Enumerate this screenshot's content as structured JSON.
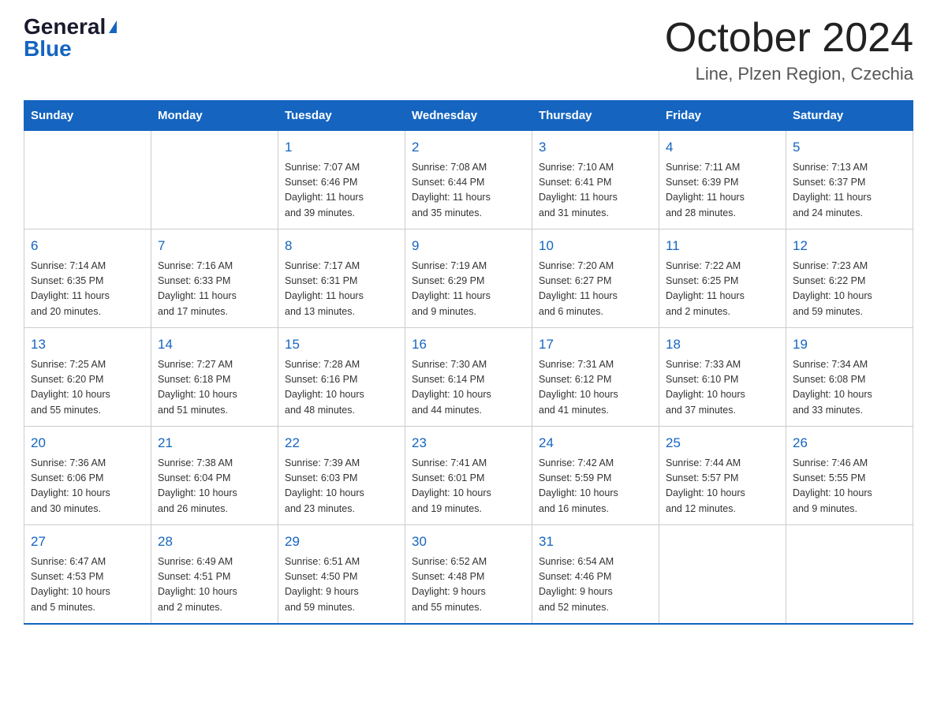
{
  "header": {
    "logo_general": "General",
    "logo_blue": "Blue",
    "title": "October 2024",
    "subtitle": "Line, Plzen Region, Czechia"
  },
  "weekdays": [
    "Sunday",
    "Monday",
    "Tuesday",
    "Wednesday",
    "Thursday",
    "Friday",
    "Saturday"
  ],
  "weeks": [
    [
      {
        "day": "",
        "info": ""
      },
      {
        "day": "",
        "info": ""
      },
      {
        "day": "1",
        "info": "Sunrise: 7:07 AM\nSunset: 6:46 PM\nDaylight: 11 hours\nand 39 minutes."
      },
      {
        "day": "2",
        "info": "Sunrise: 7:08 AM\nSunset: 6:44 PM\nDaylight: 11 hours\nand 35 minutes."
      },
      {
        "day": "3",
        "info": "Sunrise: 7:10 AM\nSunset: 6:41 PM\nDaylight: 11 hours\nand 31 minutes."
      },
      {
        "day": "4",
        "info": "Sunrise: 7:11 AM\nSunset: 6:39 PM\nDaylight: 11 hours\nand 28 minutes."
      },
      {
        "day": "5",
        "info": "Sunrise: 7:13 AM\nSunset: 6:37 PM\nDaylight: 11 hours\nand 24 minutes."
      }
    ],
    [
      {
        "day": "6",
        "info": "Sunrise: 7:14 AM\nSunset: 6:35 PM\nDaylight: 11 hours\nand 20 minutes."
      },
      {
        "day": "7",
        "info": "Sunrise: 7:16 AM\nSunset: 6:33 PM\nDaylight: 11 hours\nand 17 minutes."
      },
      {
        "day": "8",
        "info": "Sunrise: 7:17 AM\nSunset: 6:31 PM\nDaylight: 11 hours\nand 13 minutes."
      },
      {
        "day": "9",
        "info": "Sunrise: 7:19 AM\nSunset: 6:29 PM\nDaylight: 11 hours\nand 9 minutes."
      },
      {
        "day": "10",
        "info": "Sunrise: 7:20 AM\nSunset: 6:27 PM\nDaylight: 11 hours\nand 6 minutes."
      },
      {
        "day": "11",
        "info": "Sunrise: 7:22 AM\nSunset: 6:25 PM\nDaylight: 11 hours\nand 2 minutes."
      },
      {
        "day": "12",
        "info": "Sunrise: 7:23 AM\nSunset: 6:22 PM\nDaylight: 10 hours\nand 59 minutes."
      }
    ],
    [
      {
        "day": "13",
        "info": "Sunrise: 7:25 AM\nSunset: 6:20 PM\nDaylight: 10 hours\nand 55 minutes."
      },
      {
        "day": "14",
        "info": "Sunrise: 7:27 AM\nSunset: 6:18 PM\nDaylight: 10 hours\nand 51 minutes."
      },
      {
        "day": "15",
        "info": "Sunrise: 7:28 AM\nSunset: 6:16 PM\nDaylight: 10 hours\nand 48 minutes."
      },
      {
        "day": "16",
        "info": "Sunrise: 7:30 AM\nSunset: 6:14 PM\nDaylight: 10 hours\nand 44 minutes."
      },
      {
        "day": "17",
        "info": "Sunrise: 7:31 AM\nSunset: 6:12 PM\nDaylight: 10 hours\nand 41 minutes."
      },
      {
        "day": "18",
        "info": "Sunrise: 7:33 AM\nSunset: 6:10 PM\nDaylight: 10 hours\nand 37 minutes."
      },
      {
        "day": "19",
        "info": "Sunrise: 7:34 AM\nSunset: 6:08 PM\nDaylight: 10 hours\nand 33 minutes."
      }
    ],
    [
      {
        "day": "20",
        "info": "Sunrise: 7:36 AM\nSunset: 6:06 PM\nDaylight: 10 hours\nand 30 minutes."
      },
      {
        "day": "21",
        "info": "Sunrise: 7:38 AM\nSunset: 6:04 PM\nDaylight: 10 hours\nand 26 minutes."
      },
      {
        "day": "22",
        "info": "Sunrise: 7:39 AM\nSunset: 6:03 PM\nDaylight: 10 hours\nand 23 minutes."
      },
      {
        "day": "23",
        "info": "Sunrise: 7:41 AM\nSunset: 6:01 PM\nDaylight: 10 hours\nand 19 minutes."
      },
      {
        "day": "24",
        "info": "Sunrise: 7:42 AM\nSunset: 5:59 PM\nDaylight: 10 hours\nand 16 minutes."
      },
      {
        "day": "25",
        "info": "Sunrise: 7:44 AM\nSunset: 5:57 PM\nDaylight: 10 hours\nand 12 minutes."
      },
      {
        "day": "26",
        "info": "Sunrise: 7:46 AM\nSunset: 5:55 PM\nDaylight: 10 hours\nand 9 minutes."
      }
    ],
    [
      {
        "day": "27",
        "info": "Sunrise: 6:47 AM\nSunset: 4:53 PM\nDaylight: 10 hours\nand 5 minutes."
      },
      {
        "day": "28",
        "info": "Sunrise: 6:49 AM\nSunset: 4:51 PM\nDaylight: 10 hours\nand 2 minutes."
      },
      {
        "day": "29",
        "info": "Sunrise: 6:51 AM\nSunset: 4:50 PM\nDaylight: 9 hours\nand 59 minutes."
      },
      {
        "day": "30",
        "info": "Sunrise: 6:52 AM\nSunset: 4:48 PM\nDaylight: 9 hours\nand 55 minutes."
      },
      {
        "day": "31",
        "info": "Sunrise: 6:54 AM\nSunset: 4:46 PM\nDaylight: 9 hours\nand 52 minutes."
      },
      {
        "day": "",
        "info": ""
      },
      {
        "day": "",
        "info": ""
      }
    ]
  ]
}
